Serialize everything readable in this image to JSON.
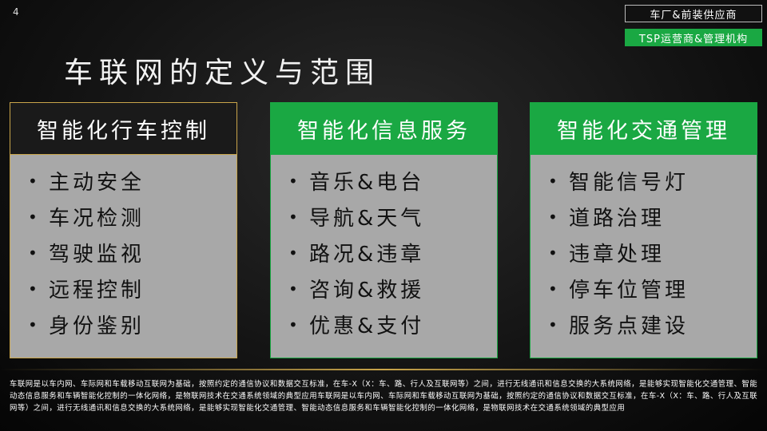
{
  "slide_number": "4",
  "tags": [
    "车厂&前装供应商",
    "TSP运营商&管理机构"
  ],
  "title": "车联网的定义与范围",
  "columns": [
    {
      "header": "智能化行车控制",
      "items": [
        "主动安全",
        "车况检测",
        "驾驶监视",
        "远程控制",
        "身份鉴别"
      ]
    },
    {
      "header": "智能化信息服务",
      "items": [
        "音乐&电台",
        "导航&天气",
        "路况&违章",
        "咨询&救援",
        "优惠&支付"
      ]
    },
    {
      "header": "智能化交通管理",
      "items": [
        "智能信号灯",
        "道路治理",
        "违章处理",
        "停车位管理",
        "服务点建设"
      ]
    }
  ],
  "bullet": "•",
  "footnote": "车联网是以车内网、车际网和车载移动互联网为基础，按照约定的通信协议和数据交互标准，在车-X（X：车、路、行人及互联网等）之间，进行无线通讯和信息交换的大系统网络，是能够实现智能化交通管理、智能动态信息服务和车辆智能化控制的一体化网络，是物联网技术在交通系统领域的典型应用车联网是以车内网、车际网和车载移动互联网为基础，按照约定的通信协议和数据交互标准，在车-X（X：车、路、行人及互联网等）之间，进行无线通讯和信息交换的大系统网络，是能够实现智能化交通管理、智能动态信息服务和车辆智能化控制的一体化网络，是物联网技术在交通系统领域的典型应用",
  "colors": {
    "accent_green": "#1aa843",
    "gold_border": "#c9a54a",
    "panel_gray": "#a8a8a8"
  }
}
